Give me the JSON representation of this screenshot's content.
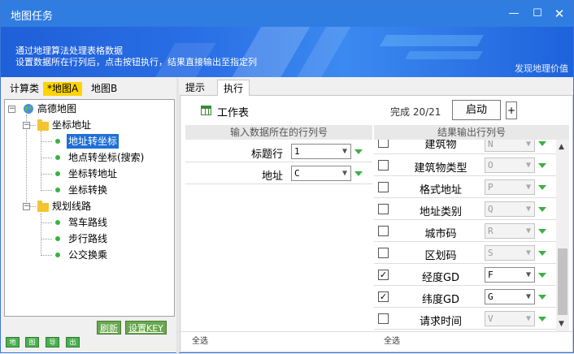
{
  "window": {
    "title": "地图任务"
  },
  "banner": {
    "line1": "通过地理算法处理表格数据",
    "line2": "设置数据所在行列后，点击按钮执行，结果直接输出至指定列",
    "brand": "发现地理价值"
  },
  "left_tabs": [
    {
      "label": "计算类",
      "active": false
    },
    {
      "label": "*地图A",
      "active": true
    },
    {
      "label": "地图B",
      "active": false
    }
  ],
  "tree": {
    "root": "高德地图",
    "groups": [
      {
        "label": "坐标地址",
        "items": [
          "地址转坐标",
          "地点转坐标(搜索)",
          "坐标转地址",
          "坐标转换"
        ]
      },
      {
        "label": "规划线路",
        "items": [
          "驾车路线",
          "步行路线",
          "公交换乘"
        ]
      }
    ],
    "selected": "地址转坐标"
  },
  "left_buttons": {
    "refresh": "刷新",
    "set_key": "设置KEY"
  },
  "mini_icons": [
    "地",
    "图",
    "导",
    "出"
  ],
  "right_tabs": [
    {
      "label": "提示",
      "active": false
    },
    {
      "label": "执行",
      "active": true
    }
  ],
  "worksheet_label": "工作表",
  "progress_text": "完成 20/21",
  "start_button": "启动",
  "plus_button": "+",
  "input_header": "输入数据所在的行列号",
  "output_header": "结果输出行列号",
  "inputs": [
    {
      "label": "标题行",
      "value": "1"
    },
    {
      "label": "地址",
      "value": "C"
    }
  ],
  "outputs": [
    {
      "label": "建筑物",
      "value": "N",
      "checked": false,
      "enabled": false
    },
    {
      "label": "建筑物类型",
      "value": "O",
      "checked": false,
      "enabled": false
    },
    {
      "label": "格式地址",
      "value": "P",
      "checked": false,
      "enabled": false
    },
    {
      "label": "地址类别",
      "value": "Q",
      "checked": false,
      "enabled": false
    },
    {
      "label": "城市码",
      "value": "R",
      "checked": false,
      "enabled": false
    },
    {
      "label": "区划码",
      "value": "S",
      "checked": false,
      "enabled": false
    },
    {
      "label": "经度GD",
      "value": "F",
      "checked": true,
      "enabled": true
    },
    {
      "label": "纬度GD",
      "value": "G",
      "checked": true,
      "enabled": true
    },
    {
      "label": "请求时间",
      "value": "V",
      "checked": false,
      "enabled": false
    }
  ],
  "footer_left": "全选",
  "footer_right": "全选",
  "accent_color": "#2f7de1",
  "highlight_color": "#ffd400",
  "icons": {
    "close": "close-icon",
    "maximize": "maximize-icon",
    "minimize": "minimize-icon",
    "worksheet": "worksheet-icon"
  }
}
